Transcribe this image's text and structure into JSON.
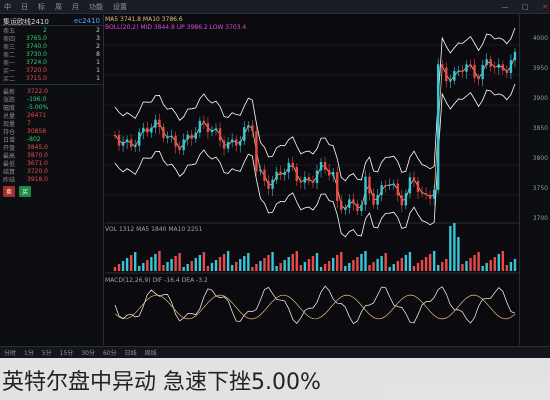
{
  "toolbar": {
    "items": [
      "中",
      "日",
      "标",
      "周",
      "月",
      "功能",
      "设置"
    ],
    "right_items": [
      "—",
      "□",
      "✕"
    ]
  },
  "sidebar": {
    "name": "集运欧线2410",
    "code": "ec2410",
    "book": [
      {
        "label": "卖五",
        "price": "2",
        "vol": "2"
      },
      {
        "label": "卖四",
        "price": "3765.0",
        "vol": "3"
      },
      {
        "label": "卖三",
        "price": "3740.0",
        "vol": "2"
      },
      {
        "label": "卖二",
        "price": "3730.0",
        "vol": "8"
      },
      {
        "label": "卖一",
        "price": "3724.0",
        "vol": "1"
      },
      {
        "label": "买一",
        "price": "3720.0",
        "vol": "1"
      },
      {
        "label": "买二",
        "price": "3715.0",
        "vol": "1"
      }
    ],
    "quote": [
      {
        "k": "最新",
        "v": "3722.0"
      },
      {
        "k": "涨跌",
        "v": "-196.0"
      },
      {
        "k": "幅度",
        "v": "-5.00%"
      },
      {
        "k": "总量",
        "v": "26471"
      },
      {
        "k": "现量",
        "v": "7"
      },
      {
        "k": "持仓",
        "v": "30858"
      },
      {
        "k": "日增",
        "v": "-802"
      },
      {
        "k": "开盘",
        "v": "3845.0"
      },
      {
        "k": "最高",
        "v": "3870.0"
      },
      {
        "k": "最低",
        "v": "3671.0"
      },
      {
        "k": "结算",
        "v": "3720.0"
      },
      {
        "k": "昨结",
        "v": "3918.0"
      }
    ],
    "badges": {
      "sell": "卖",
      "buy": "买"
    }
  },
  "chart": {
    "info1": "MA5 3741.8 MA10 3786.6",
    "info2": "BOLL(20,2) MID 3844.8 UP 3986.2 LOW 3703.4",
    "vol_info": "VOL 1312 MA5 1840 MA10 2251",
    "macd_info": "MACD(12,26,9) DIF -16.4 DEA -3.2",
    "axis": [
      "4000",
      "3950",
      "3900",
      "3850",
      "3800",
      "3750",
      "3700"
    ],
    "colors": {
      "up": "#e84a4a",
      "down": "#2ecc71",
      "upper": "#d94cd9",
      "mid": "#e5c07b",
      "low": "#ffffff"
    }
  },
  "status": [
    "分时",
    "1分",
    "5分",
    "15分",
    "30分",
    "60分",
    "日线",
    "周线"
  ],
  "caption": "英特尔盘中异动 急速下挫5.00%"
}
